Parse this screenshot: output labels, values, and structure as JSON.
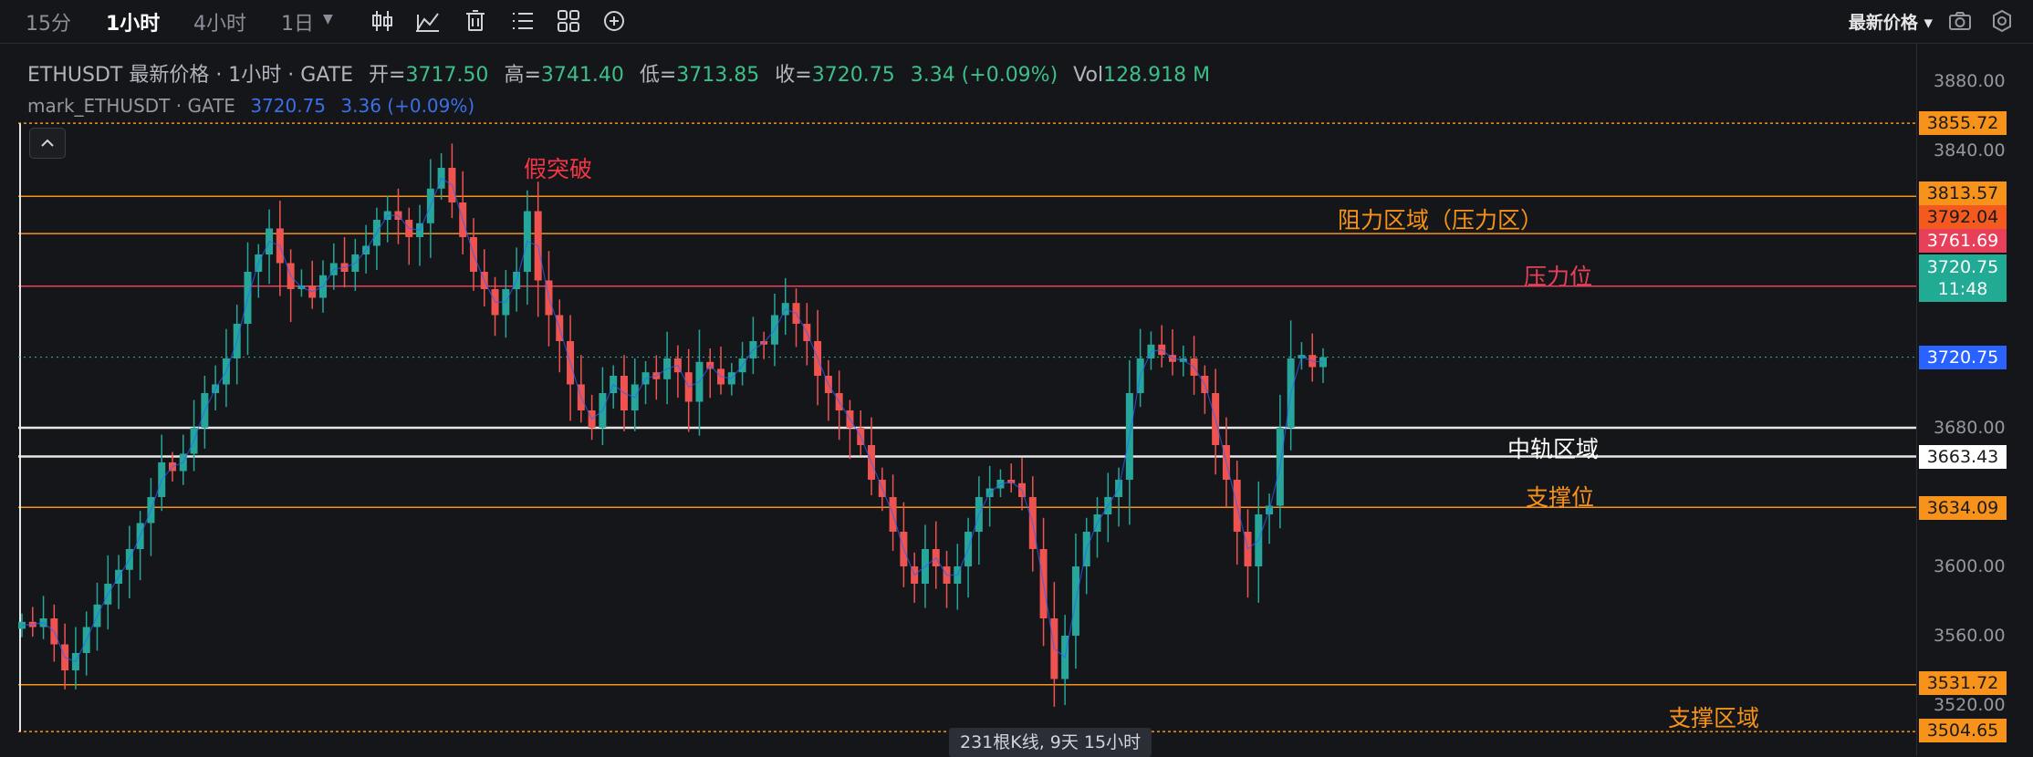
{
  "toolbar": {
    "timeframes": [
      "15分",
      "1小时",
      "4小时",
      "1日"
    ],
    "active_timeframe": "1小时",
    "icons": [
      "candle-type-icon",
      "indicator-icon",
      "delete-icon",
      "list-icon",
      "layout-icon",
      "add-icon"
    ],
    "price_type": "最新价格",
    "right_icons": [
      "camera-icon",
      "settings-icon"
    ]
  },
  "legend": {
    "symbol": "ETHUSDT 最新价格 · 1小时 · GATE",
    "open_label": "开=",
    "open": "3717.50",
    "high_label": "高=",
    "high": "3741.40",
    "low_label": "低=",
    "low": "3713.85",
    "close_label": "收=",
    "close": "3720.75",
    "change": "3.34 (+0.09%)",
    "vol_label": "Vol",
    "vol": "128.918 M"
  },
  "legend2": {
    "name": "mark_ETHUSDT · GATE",
    "value": "3720.75",
    "change": "3.36 (+0.09%)"
  },
  "axis": {
    "ticks": [
      "3880.00",
      "3840.00",
      "3680.00",
      "3600.00",
      "3560.00",
      "3520.00"
    ]
  },
  "price_labels": {
    "p3855": "3855.72",
    "p3813": "3813.57",
    "p3792": "3792.04",
    "p3761": "3761.69",
    "last_price": "3720.75",
    "countdown": "11:48",
    "mark_price": "3720.75",
    "p3663": "3663.43",
    "p3634": "3634.09",
    "p3531": "3531.72",
    "p3504": "3504.65"
  },
  "annotations": {
    "fake_breakout": "假突破",
    "resistance_zone": "阻力区域（压力区）",
    "resistance": "压力位",
    "middle_zone": "中轨区域",
    "support": "支撑位",
    "support_zone": "支撑区域"
  },
  "status": "231根K线, 9天 15小时",
  "colors": {
    "up": "#26a69a",
    "down": "#ef5350",
    "orange": "#f7931a",
    "red_line": "#e8405a",
    "blue": "#2962ff",
    "bg": "#151619"
  },
  "chart_data": {
    "type": "candlestick",
    "symbol": "ETHUSDT",
    "interval": "1小时",
    "ylim": [
      3500,
      3900
    ],
    "last_close": 3720.75,
    "horizontal_levels": [
      3855.72,
      3813.57,
      3792.04,
      3761.69,
      3680.0,
      3663.43,
      3634.09,
      3531.72,
      3504.65
    ],
    "close": [
      3568,
      3565,
      3570,
      3555,
      3540,
      3550,
      3565,
      3578,
      3590,
      3598,
      3610,
      3625,
      3640,
      3660,
      3655,
      3665,
      3680,
      3700,
      3705,
      3720,
      3740,
      3770,
      3780,
      3795,
      3775,
      3760,
      3762,
      3755,
      3768,
      3775,
      3770,
      3780,
      3785,
      3800,
      3805,
      3800,
      3790,
      3798,
      3818,
      3830,
      3810,
      3790,
      3770,
      3760,
      3745,
      3760,
      3770,
      3805,
      3765,
      3745,
      3730,
      3705,
      3690,
      3680,
      3700,
      3710,
      3690,
      3705,
      3712,
      3708,
      3720,
      3712,
      3695,
      3718,
      3714,
      3705,
      3712,
      3720,
      3730,
      3728,
      3745,
      3752,
      3740,
      3730,
      3710,
      3700,
      3690,
      3680,
      3670,
      3650,
      3640,
      3620,
      3600,
      3590,
      3610,
      3600,
      3590,
      3600,
      3620,
      3640,
      3645,
      3650,
      3648,
      3640,
      3610,
      3570,
      3535,
      3560,
      3600,
      3620,
      3630,
      3640,
      3650,
      3700,
      3720,
      3728,
      3722,
      3718,
      3720,
      3710,
      3700,
      3670,
      3650,
      3620,
      3600,
      3630,
      3635,
      3680,
      3720,
      3722,
      3715,
      3720.75
    ]
  }
}
